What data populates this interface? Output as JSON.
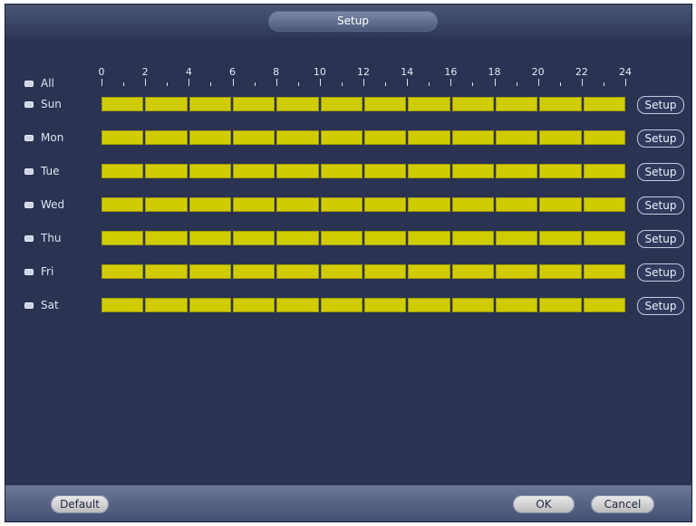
{
  "window": {
    "title": "Setup"
  },
  "all_label": "All",
  "hours": [
    "0",
    "2",
    "4",
    "6",
    "8",
    "10",
    "12",
    "14",
    "16",
    "18",
    "20",
    "22",
    "24"
  ],
  "days": [
    {
      "label": "Sun",
      "setup": "Setup"
    },
    {
      "label": "Mon",
      "setup": "Setup"
    },
    {
      "label": "Tue",
      "setup": "Setup"
    },
    {
      "label": "Wed",
      "setup": "Setup"
    },
    {
      "label": "Thu",
      "setup": "Setup"
    },
    {
      "label": "Fri",
      "setup": "Setup"
    },
    {
      "label": "Sat",
      "setup": "Setup"
    }
  ],
  "schedule_color": "#d1cc00",
  "footer": {
    "default": "Default",
    "ok": "OK",
    "cancel": "Cancel"
  }
}
